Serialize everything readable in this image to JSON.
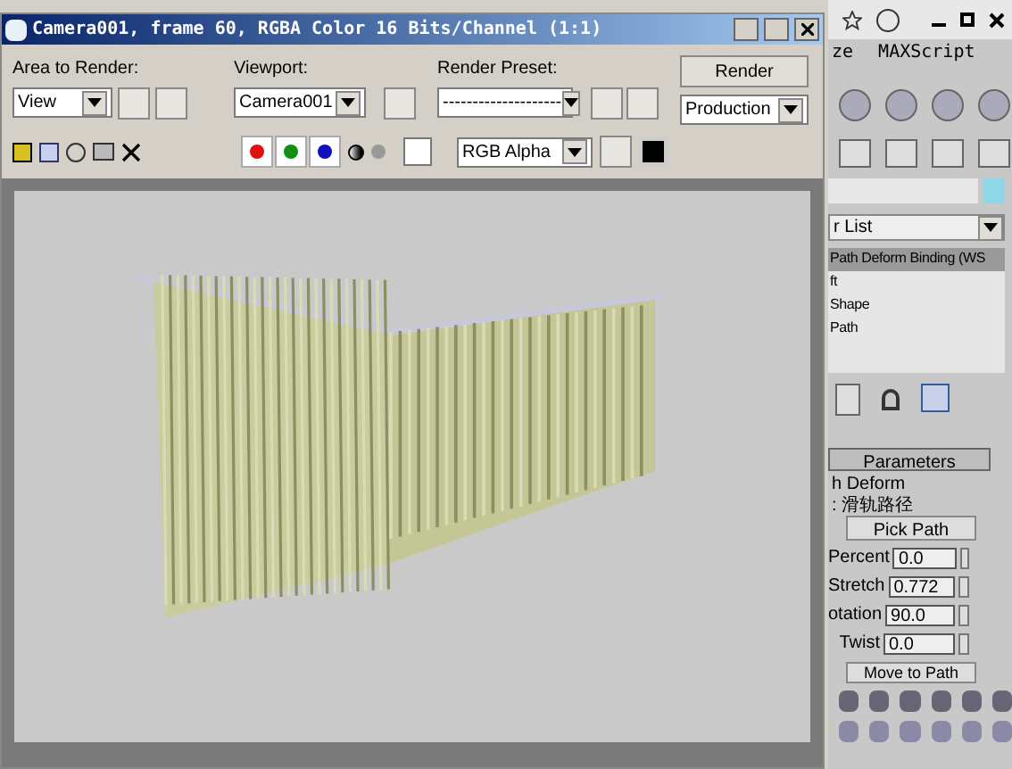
{
  "window": {
    "title": "Camera001, frame 60, RGBA Color 16 Bits/Channel (1:1)"
  },
  "controls": {
    "area_label": "Area to Render:",
    "area_value": "View",
    "viewport_label": "Viewport:",
    "viewport_value": "Camera001",
    "preset_label": "Render Preset:",
    "preset_value": "--------------------",
    "render_button": "Render",
    "mode_value": "Production",
    "channel_value": "RGB Alpha"
  },
  "channels": [
    {
      "color": "#e01010",
      "on": true
    },
    {
      "color": "#109010",
      "on": true
    },
    {
      "color": "#1010c0",
      "on": true
    }
  ],
  "background_app": {
    "menu": [
      "ze",
      "MAXScript"
    ],
    "modifier_list": "r List",
    "stack": [
      {
        "label": "Path Deform Binding (WS",
        "selected": true
      },
      {
        "label": "ft",
        "selected": false
      },
      {
        "label": "Shape",
        "selected": false
      },
      {
        "label": "Path",
        "selected": false
      }
    ],
    "rollout": "Parameters",
    "group": "h Deform",
    "path_label": ": 滑轨路径",
    "pick_button": "Pick Path",
    "fields": [
      {
        "label": "Percent",
        "value": "0.0"
      },
      {
        "label": "Stretch",
        "value": "0.772"
      },
      {
        "label": "otation",
        "value": "90.0"
      },
      {
        "label": "Twist",
        "value": "0.0"
      }
    ],
    "move_button": "Move to Path"
  }
}
